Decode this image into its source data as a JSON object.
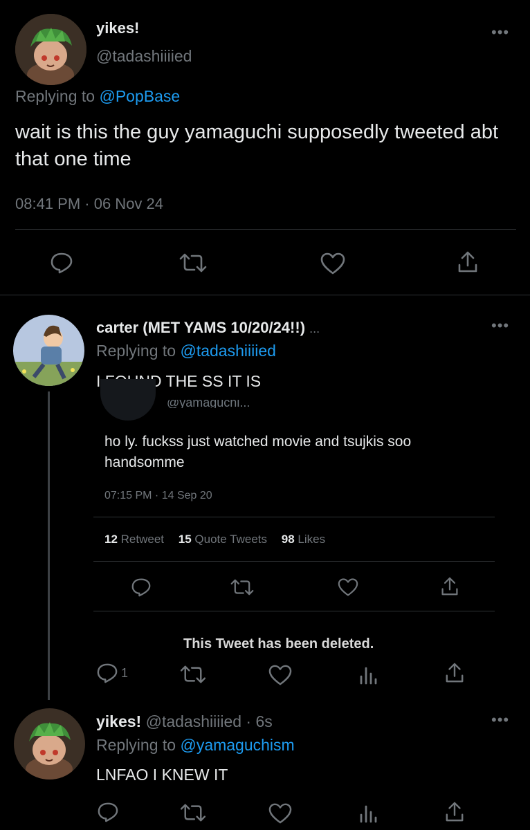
{
  "main_tweet": {
    "display_name": "yikes!",
    "handle": "@tadashiiiied",
    "replying_prefix": "Replying to",
    "replying_to": "@PopBase",
    "text": "wait is this the guy yamaguchi supposedly tweeted abt that one time",
    "timestamp": "08:41 PM · 06 Nov 24"
  },
  "reply1": {
    "display_name": "carter (MET YAMS 10/20/24!!)",
    "ellipsis": "...",
    "replying_prefix": "Replying to",
    "replying_to": "@tadashiiiied",
    "text": "I FOUND THE SS IT IS",
    "screenshot": {
      "cut_handle": "@yamaguchi...",
      "text": "ho ly. fuckss just watched movie and tsujkis soo handsomme",
      "timestamp": "07:15 PM · 14 Sep 20",
      "retweets_count": "12",
      "retweets_label": "Retweet",
      "quotes_count": "15",
      "quotes_label": "Quote Tweets",
      "likes_count": "98",
      "likes_label": "Likes"
    },
    "deleted_notice": "This Tweet has been deleted.",
    "reply_count": "1"
  },
  "reply2": {
    "display_name": "yikes!",
    "handle_time": "@tadashiiiied · 6s",
    "replying_prefix": "Replying to",
    "replying_to": "@yamaguchism",
    "text": "LNFAO I KNEW IT"
  },
  "icons": [
    "reply-icon",
    "retweet-icon",
    "like-icon",
    "share-icon",
    "analytics-icon",
    "more-icon"
  ],
  "colors": {
    "background": "#000000",
    "text": "#e7e9ea",
    "muted": "#71767b",
    "link": "#1d9bf0",
    "divider": "#2f3336"
  }
}
